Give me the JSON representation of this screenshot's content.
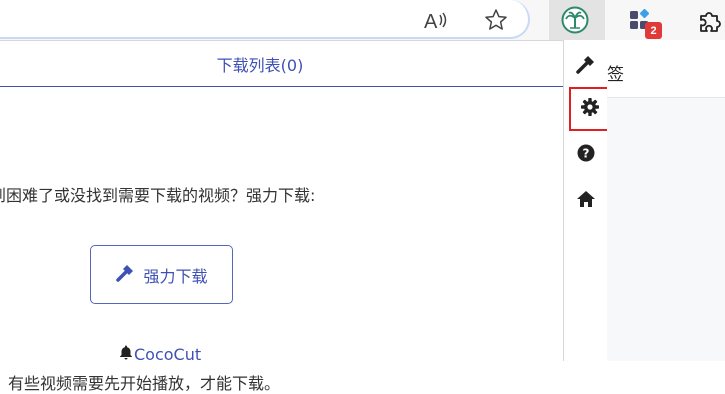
{
  "toolbar": {
    "icons": [
      "read-aloud-icon",
      "favorite-star-icon",
      "coconut-tree-extension-icon",
      "extensions-badge-icon",
      "puzzle-icon"
    ],
    "extension_badge_count": "2"
  },
  "popup": {
    "header_title": "下载列表(0)",
    "tip_text": "碰到困难了或没找到需要下载的视频？强力下载:",
    "force_download_label": "强力下载",
    "brand_link": "CocoCut",
    "note": "有些视频需要先开始播放，才能下载。"
  },
  "sidebar": {
    "buttons": [
      "hammer-icon",
      "gear-icon",
      "help-icon",
      "home-icon"
    ]
  },
  "page": {
    "partial_label": "签"
  },
  "colors": {
    "accent": "#3f51b5",
    "highlight": "#e02020",
    "badge": "#e0393a"
  }
}
